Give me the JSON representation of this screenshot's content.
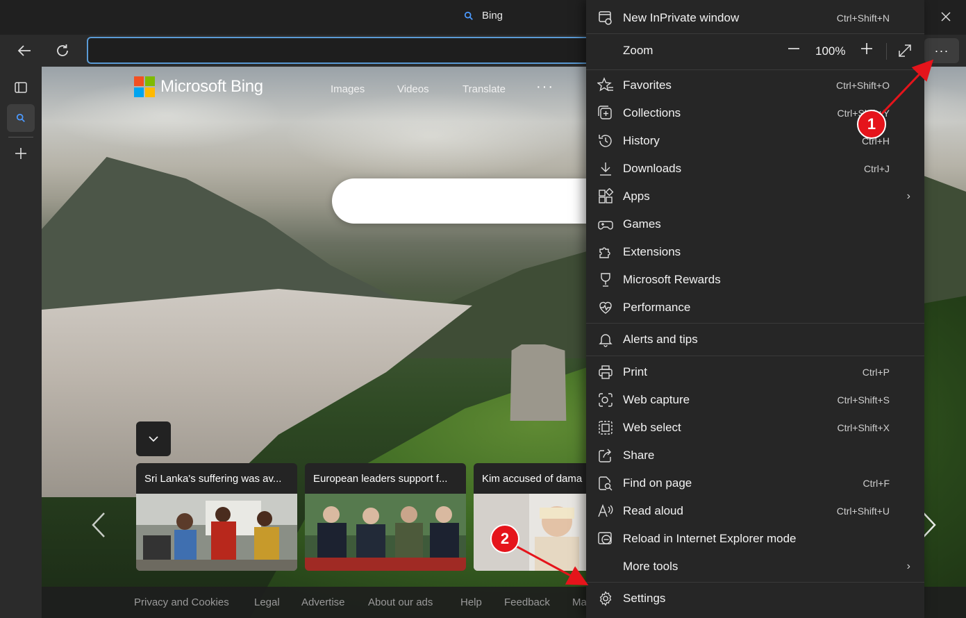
{
  "tab": {
    "title": "Bing"
  },
  "toolbar": {
    "address_value": "",
    "more_label": "···"
  },
  "bing": {
    "logo_text": "Microsoft Bing",
    "nav": [
      "Images",
      "Videos",
      "Translate"
    ],
    "more": "···"
  },
  "news": [
    {
      "title": "Sri Lanka's suffering was av..."
    },
    {
      "title": "European leaders support f..."
    },
    {
      "title": "Kim accused of dama"
    }
  ],
  "footer": {
    "links": [
      "Privacy and Cookies",
      "Legal",
      "Advertise",
      "About our ads",
      "Help",
      "Feedback",
      "Ma"
    ]
  },
  "menu": {
    "new_inprivate": {
      "label": "New InPrivate window",
      "shortcut": "Ctrl+Shift+N"
    },
    "zoom": {
      "label": "Zoom",
      "value": "100%",
      "minus": "—",
      "plus": "+"
    },
    "items": [
      {
        "label": "Favorites",
        "shortcut": "Ctrl+Shift+O"
      },
      {
        "label": "Collections",
        "shortcut": "Ctrl+Shift+Y"
      },
      {
        "label": "History",
        "shortcut": "Ctrl+H"
      },
      {
        "label": "Downloads",
        "shortcut": "Ctrl+J"
      },
      {
        "label": "Apps",
        "shortcut": ""
      },
      {
        "label": "Games",
        "shortcut": ""
      },
      {
        "label": "Extensions",
        "shortcut": ""
      },
      {
        "label": "Microsoft Rewards",
        "shortcut": ""
      },
      {
        "label": "Performance",
        "shortcut": ""
      },
      {
        "label": "Alerts and tips",
        "shortcut": ""
      },
      {
        "label": "Print",
        "shortcut": "Ctrl+P"
      },
      {
        "label": "Web capture",
        "shortcut": "Ctrl+Shift+S"
      },
      {
        "label": "Web select",
        "shortcut": "Ctrl+Shift+X"
      },
      {
        "label": "Share",
        "shortcut": ""
      },
      {
        "label": "Find on page",
        "shortcut": "Ctrl+F"
      },
      {
        "label": "Read aloud",
        "shortcut": "Ctrl+Shift+U"
      },
      {
        "label": "Reload in Internet Explorer mode",
        "shortcut": ""
      },
      {
        "label": "More tools",
        "shortcut": ""
      },
      {
        "label": "Settings",
        "shortcut": ""
      }
    ]
  },
  "annotations": {
    "step1": "1",
    "step2": "2",
    "color": "#e5141b"
  },
  "colors": {
    "menu_bg": "#262626",
    "chrome_bg": "#2b2b2b",
    "accent": "#5b9bd5"
  }
}
